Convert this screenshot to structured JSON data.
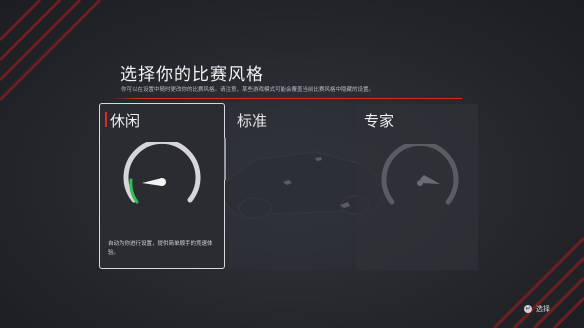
{
  "header": {
    "title": "选择你的比赛风格",
    "subtitle": "你可以在设置中随时更改你的比赛风格。请注意，某些游戏模式可能会覆盖当前比赛风格中隐藏的设置。"
  },
  "cards": [
    {
      "label": "休闲",
      "description": "自动为你进行设置，提供简单顺手的竞速体验。",
      "selected": true
    },
    {
      "label": "标准",
      "selected": false
    },
    {
      "label": "专家",
      "selected": false
    }
  ],
  "footer": {
    "select_label": "选择",
    "select_icon": "enter-icon"
  },
  "colors": {
    "accent": "#d92a2a",
    "gauge_green": "#2fbf55",
    "background": "#23252a"
  }
}
